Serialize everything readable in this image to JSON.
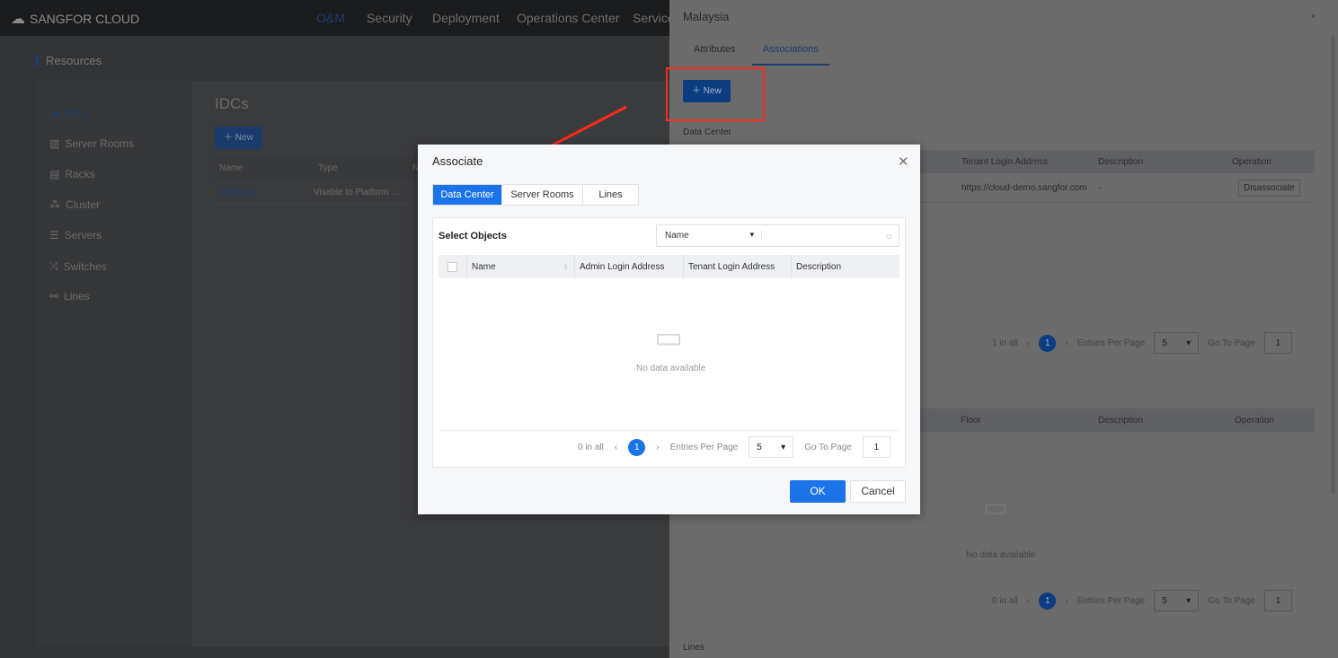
{
  "topbar": {
    "brand": "SANGFOR CLOUD",
    "nav": [
      "O&M",
      "Security",
      "Deployment",
      "Operations Center",
      "Service"
    ]
  },
  "page": {
    "section": "Resources",
    "title": "IDCs",
    "new_label": "New"
  },
  "sidebar": {
    "items": [
      {
        "label": "IDCs",
        "icon": "cloud-icon"
      },
      {
        "label": "Server Rooms",
        "icon": "building-icon"
      },
      {
        "label": "Racks",
        "icon": "rack-icon"
      },
      {
        "label": "Cluster",
        "icon": "cluster-icon"
      },
      {
        "label": "Servers",
        "icon": "server-icon"
      },
      {
        "label": "Switches",
        "icon": "shuffle-icon"
      },
      {
        "label": "Lines",
        "icon": "lines-icon"
      }
    ]
  },
  "idc_table": {
    "columns": [
      "Name",
      "Type",
      "N"
    ],
    "rows": [
      [
        "Malaysia",
        "Visable to Platform ..."
      ]
    ]
  },
  "drawer": {
    "title": "Malaysia",
    "close": "×",
    "tabs": [
      "Attributes",
      "Associations"
    ],
    "active_tab": "Associations",
    "new_label": "New",
    "dc_section": "Data Center",
    "dc_table": {
      "columns": [
        "Tenant Login Address",
        "Description",
        "Operation"
      ],
      "rows": [
        [
          "https://cloud-demo.sangfor.com",
          "-",
          "Disassociate"
        ]
      ]
    },
    "pag1": {
      "total": "1 in all",
      "page": "1",
      "entries_label": "Entries Per Page",
      "entries": "5",
      "goto_label": "Go To Page",
      "goto": "1"
    },
    "sr_table": {
      "columns": [
        "Floor",
        "Description",
        "Operation"
      ],
      "empty": "No data available"
    },
    "pag2": {
      "total": "0 in all",
      "page": "1",
      "entries_label": "Entries Per Page",
      "entries": "5",
      "goto_label": "Go To Page",
      "goto": "1"
    },
    "lines_section": "Lines"
  },
  "modal": {
    "title": "Associate",
    "tabs": [
      "Data Center",
      "Server Rooms",
      "Lines"
    ],
    "active_tab": "Data Center",
    "select_label": "Select Objects",
    "filter": "Name",
    "search_placeholder": "",
    "columns": [
      "Name",
      "Admin Login Address",
      "Tenant Login Address",
      "Description"
    ],
    "empty": "No data available",
    "pag": {
      "total": "0 in all",
      "page": "1",
      "entries_label": "Entries Per Page",
      "entries": "5",
      "goto_label": "Go To Page",
      "goto": "1"
    },
    "ok": "OK",
    "cancel": "Cancel"
  },
  "colors": {
    "accent": "#1a73e8",
    "annotation": "#ff2a1f"
  }
}
